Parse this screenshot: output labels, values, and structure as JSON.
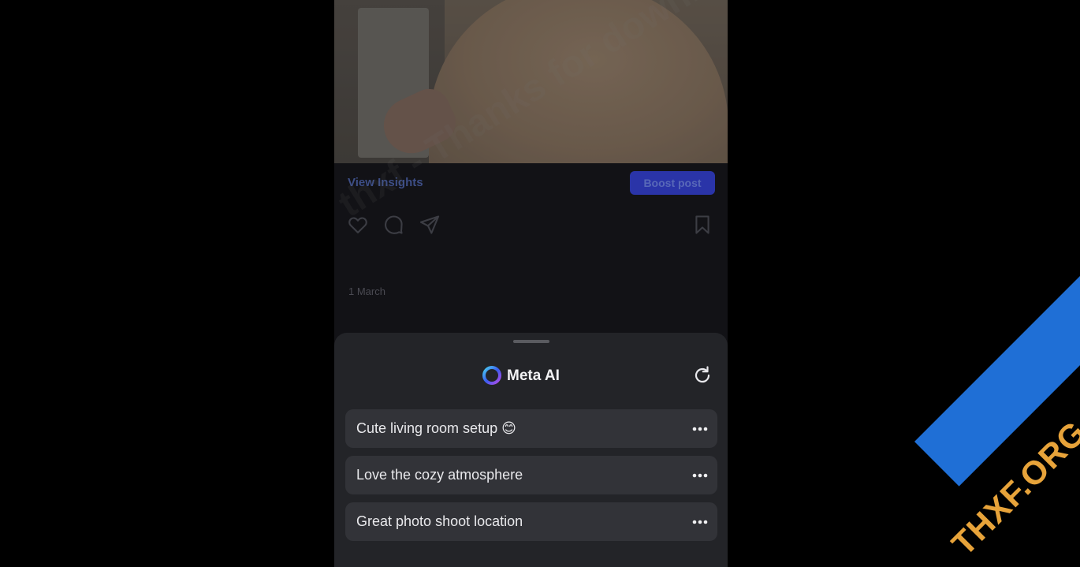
{
  "post": {
    "view_insights_label": "View Insights",
    "boost_label": "Boost post",
    "date": "1 March"
  },
  "actions": {
    "like_icon": "heart-icon",
    "comment_icon": "comment-icon",
    "share_icon": "send-icon",
    "save_icon": "bookmark-icon"
  },
  "sheet": {
    "title": "Meta AI",
    "logo_icon": "meta-ai-ring-icon",
    "refresh_icon": "refresh-icon",
    "suggestions": [
      {
        "text": "Cute living room setup 😊"
      },
      {
        "text": "Love the cozy atmosphere"
      },
      {
        "text": "Great photo shoot location"
      }
    ]
  },
  "overlay": {
    "watermark_text": "thxf - Thanks for downloading",
    "brand_text": "THXF.ORG"
  },
  "colors": {
    "background": "#000000",
    "sheet": "#232428",
    "suggestion": "#323338",
    "boost": "#2a34a8",
    "brand_blue": "#1f6fd6",
    "brand_orange": "#e7a33a"
  }
}
